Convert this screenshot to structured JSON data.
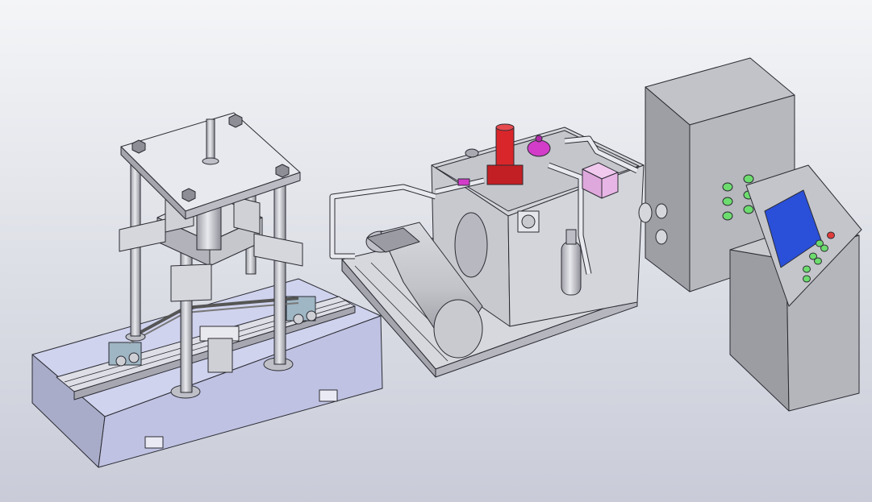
{
  "colors": {
    "background_top": "#f4f5f7",
    "background_bottom": "#c9ccd8",
    "base_blue": "#c4c8e8",
    "steel_light": "#e6e7ec",
    "steel_mid": "#c7c8ce",
    "steel_dark": "#9d9ea6",
    "cabinet_gray": "#b7b8bd",
    "red_part": "#d9262b",
    "magenta_part": "#d23cc8",
    "pink_block": "#e8b6e6",
    "button_green": "#6ddc6e",
    "button_red": "#e23b3b",
    "screen_blue": "#2a4fd8",
    "outline": "#2b2c33"
  },
  "objects": [
    "test-frame-with-base-rail",
    "hydraulic-power-unit",
    "electric-cabinet",
    "control-console"
  ]
}
